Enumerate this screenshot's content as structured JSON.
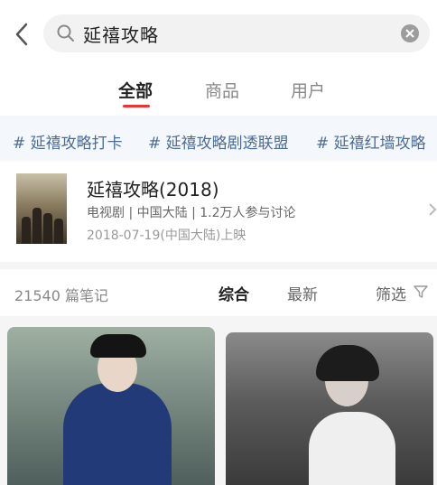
{
  "search": {
    "query": "延禧攻略"
  },
  "tabs": [
    {
      "label": "全部",
      "active": true
    },
    {
      "label": "商品",
      "active": false
    },
    {
      "label": "用户",
      "active": false
    }
  ],
  "hashtags": [
    "# 延禧攻略打卡",
    "# 延禧攻略剧透联盟",
    "# 延禧红墙攻略"
  ],
  "result": {
    "title": "延禧攻略(2018)",
    "meta": "电视剧 | 中国大陆 | 1.2万人参与讨论",
    "date": "2018-07-19(中国大陆)上映"
  },
  "notes": {
    "count": "21540 篇笔记",
    "sort": [
      "综合",
      "最新"
    ],
    "filter": "筛选"
  },
  "colors": {
    "accent": "#e33333",
    "tag": "#4a6d98"
  },
  "icons": [
    "back-arrow-icon",
    "search-icon",
    "clear-icon",
    "chevron-right-icon",
    "filter-icon"
  ]
}
